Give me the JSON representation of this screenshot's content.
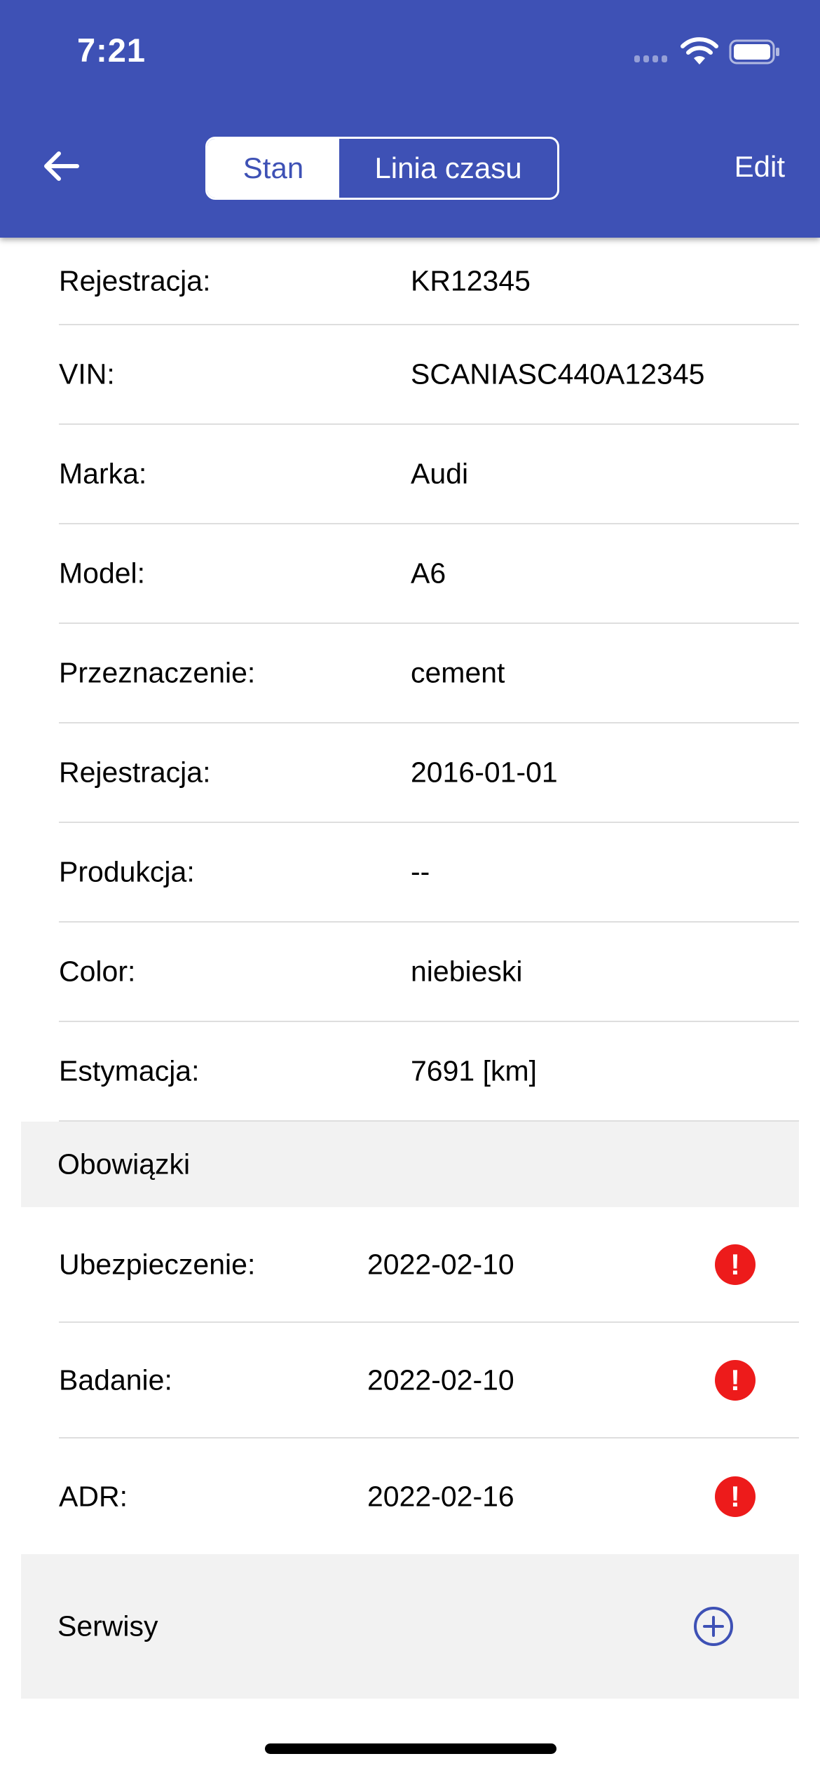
{
  "status_bar": {
    "time": "7:21"
  },
  "nav": {
    "back_icon": "arrow-left-icon",
    "tabs": [
      {
        "label": "Stan",
        "active": true
      },
      {
        "label": "Linia czasu",
        "active": false
      }
    ],
    "edit_label": "Edit"
  },
  "details": [
    {
      "label": "Rejestracja:",
      "value": "KR12345"
    },
    {
      "label": "VIN:",
      "value": "SCANIASC440A12345"
    },
    {
      "label": "Marka:",
      "value": "Audi"
    },
    {
      "label": "Model:",
      "value": "A6"
    },
    {
      "label": "Przeznaczenie:",
      "value": "cement"
    },
    {
      "label": "Rejestracja:",
      "value": "2016-01-01"
    },
    {
      "label": "Produkcja:",
      "value": "--"
    },
    {
      "label": "Color:",
      "value": "niebieski"
    },
    {
      "label": "Estymacja:",
      "value": "7691 [km]"
    }
  ],
  "obligations": {
    "title": "Obowiązki",
    "items": [
      {
        "label": "Ubezpieczenie:",
        "date": "2022-02-10",
        "alert": "!"
      },
      {
        "label": "Badanie:",
        "date": "2022-02-10",
        "alert": "!"
      },
      {
        "label": "ADR:",
        "date": "2022-02-16",
        "alert": "!"
      }
    ]
  },
  "services": {
    "title": "Serwisy",
    "add_icon": "plus-circle-icon"
  },
  "colors": {
    "header": "#3E51B5",
    "alert": "#ED1B1B",
    "section_bg": "#F2F2F2"
  }
}
